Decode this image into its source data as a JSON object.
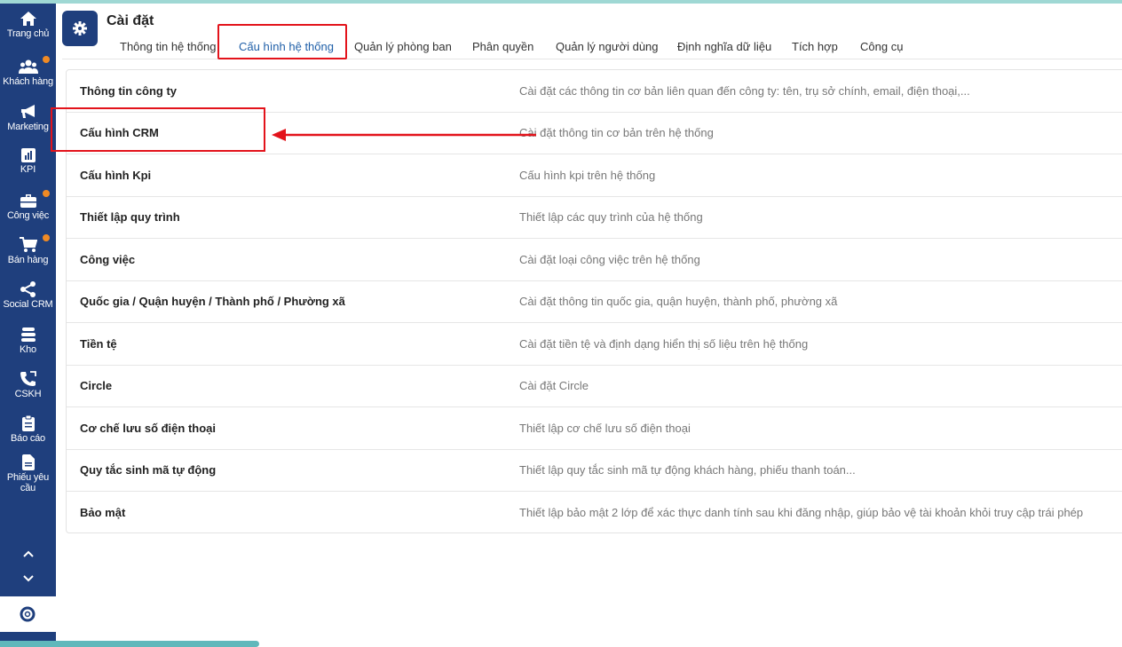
{
  "sidebar": {
    "items": [
      {
        "label": "Trang chủ",
        "icon": "home-icon"
      },
      {
        "label": "Khách hàng",
        "icon": "users-icon",
        "badge": true
      },
      {
        "label": "Marketing",
        "icon": "megaphone-icon"
      },
      {
        "label": "KPI",
        "icon": "chart-icon"
      },
      {
        "label": "Công việc",
        "icon": "briefcase-icon",
        "badge": true
      },
      {
        "label": "Bán hàng",
        "icon": "cart-icon",
        "badge": true
      },
      {
        "label": "Social CRM",
        "icon": "share-icon"
      },
      {
        "label": "Kho",
        "icon": "warehouse-icon"
      },
      {
        "label": "CSKH",
        "icon": "phone-icon"
      },
      {
        "label": "Báo cáo",
        "icon": "clipboard-icon"
      },
      {
        "label": "Phiếu yêu cầu",
        "icon": "document-icon"
      }
    ]
  },
  "header": {
    "title": "Cài đặt",
    "icon": "gear-icon"
  },
  "tabs": [
    {
      "label": "Thông tin hệ thống",
      "active": false
    },
    {
      "label": "Cấu hình hệ thống",
      "active": true
    },
    {
      "label": "Quản lý phòng ban",
      "active": false
    },
    {
      "label": "Phân quyền",
      "active": false
    },
    {
      "label": "Quản lý người dùng",
      "active": false
    },
    {
      "label": "Định nghĩa dữ liệu",
      "active": false
    },
    {
      "label": "Tích hợp",
      "active": false
    },
    {
      "label": "Công cụ",
      "active": false
    }
  ],
  "settings": [
    {
      "name": "Thông tin công ty",
      "description": "Cài đặt các thông tin cơ bản liên quan đến công ty: tên, trụ sở chính, email, điện thoại,..."
    },
    {
      "name": "Cấu hình CRM",
      "description": "Cài đặt thông tin cơ bản trên hệ thống"
    },
    {
      "name": "Cấu hình Kpi",
      "description": "Cấu hình kpi trên hệ thống"
    },
    {
      "name": "Thiết lập quy trình",
      "description": "Thiết lập các quy trình của hệ thống"
    },
    {
      "name": "Công việc",
      "description": "Cài đặt loại công việc trên hệ thống"
    },
    {
      "name": "Quốc gia / Quận huyện / Thành phố / Phường xã",
      "description": "Cài đặt thông tin quốc gia, quận huyện, thành phố, phường xã"
    },
    {
      "name": "Tiền tệ",
      "description": "Cài đặt tiền tệ và định dạng hiển thị số liệu trên hệ thống"
    },
    {
      "name": "Circle",
      "description": "Cài đặt Circle"
    },
    {
      "name": "Cơ chế lưu số điện thoại",
      "description": "Thiết lập cơ chế lưu số điện thoại"
    },
    {
      "name": "Quy tắc sinh mã tự động",
      "description": "Thiết lập quy tắc sinh mã tự động khách hàng, phiếu thanh toán..."
    },
    {
      "name": "Bảo mật",
      "description": "Thiết lập bảo mật 2 lớp để xác thực danh tính sau khi đăng nhập, giúp bảo vệ tài khoản khỏi truy cập trái phép"
    }
  ],
  "colors": {
    "sidebar": "#1f3f7d",
    "accent": "#1f5fa8",
    "badge": "#f08a24",
    "annotation": "#e3131b"
  }
}
